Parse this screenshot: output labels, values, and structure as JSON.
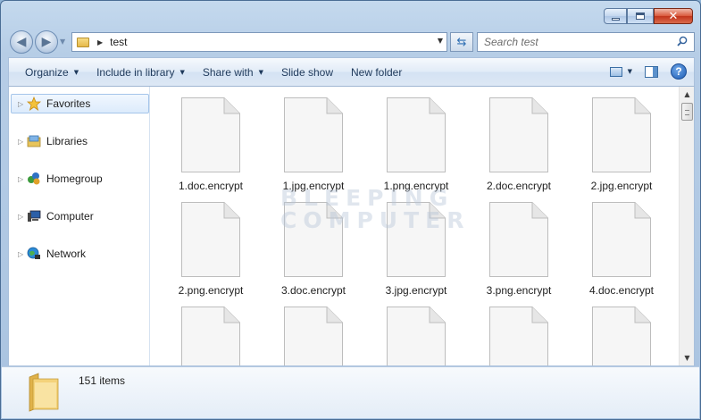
{
  "window": {
    "caption_buttons": [
      "minimize",
      "maximize",
      "close"
    ]
  },
  "address_bar": {
    "path_segments": [
      "test"
    ]
  },
  "search": {
    "placeholder": "Search test"
  },
  "command_bar": {
    "organize": "Organize",
    "include_in_library": "Include in library",
    "share_with": "Share with",
    "slide_show": "Slide show",
    "new_folder": "New folder"
  },
  "nav_pane": {
    "items": [
      {
        "label": "Favorites",
        "icon": "star-icon"
      },
      {
        "label": "Libraries",
        "icon": "library-icon"
      },
      {
        "label": "Homegroup",
        "icon": "homegroup-icon"
      },
      {
        "label": "Computer",
        "icon": "computer-icon"
      },
      {
        "label": "Network",
        "icon": "network-icon"
      }
    ]
  },
  "files": [
    "1.doc.encrypt",
    "1.jpg.encrypt",
    "1.png.encrypt",
    "2.doc.encrypt",
    "2.jpg.encrypt",
    "2.png.encrypt",
    "3.doc.encrypt",
    "3.jpg.encrypt",
    "3.png.encrypt",
    "4.doc.encrypt",
    "",
    "",
    "",
    "",
    ""
  ],
  "watermark": {
    "line1": "BLEEPING",
    "line2": "COMPUTER"
  },
  "details_pane": {
    "item_count": "151 items"
  },
  "colors": {
    "window_frame": "#b6cde6",
    "command_text": "#1e395b",
    "selection_border": "#a5c5ea"
  }
}
